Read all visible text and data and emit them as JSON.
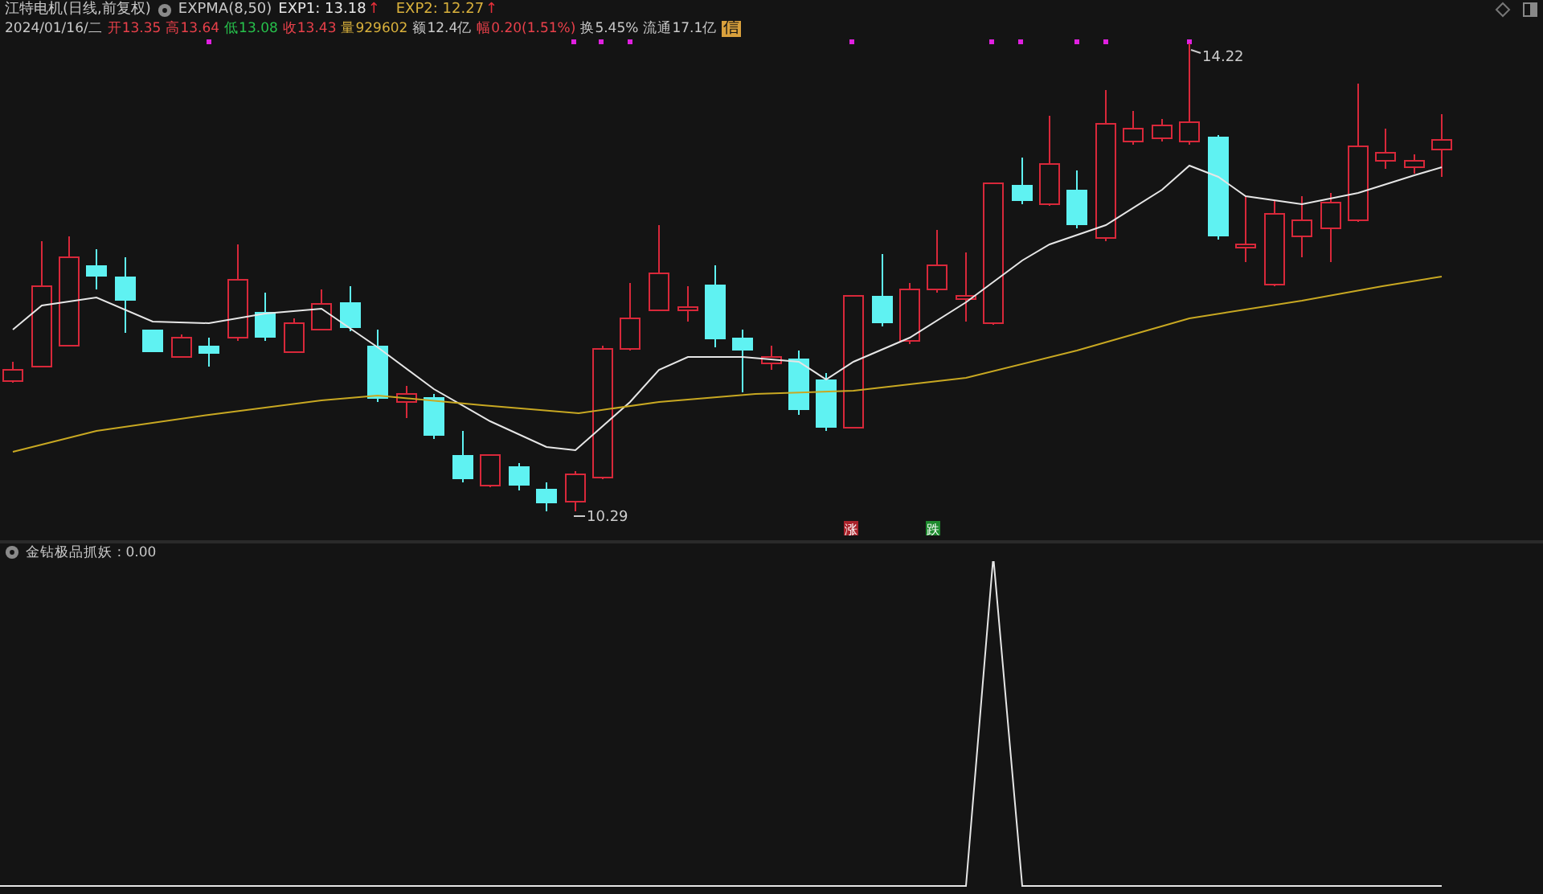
{
  "header": {
    "title": "江特电机(日线,前复权)",
    "indicator": "EXPMA(8,50)",
    "exp1": {
      "text": "EXP1: 13.18",
      "arrow": "↑"
    },
    "exp2": {
      "text": "EXP2: 12.27",
      "arrow": "↑"
    }
  },
  "quote": {
    "date": "2024/01/16/二",
    "badge": "信",
    "fields": [
      {
        "label": "开",
        "value": "13.35",
        "color": "#e8404a"
      },
      {
        "label": "高",
        "value": "13.64",
        "color": "#e8404a"
      },
      {
        "label": "低",
        "value": "13.08",
        "color": "#27c24c"
      },
      {
        "label": "收",
        "value": "13.43",
        "color": "#e8404a"
      },
      {
        "label": "量",
        "value": "929602",
        "color": "#d9b13c"
      },
      {
        "label": "额",
        "value": "12.4亿",
        "color": "#c8c8c8"
      },
      {
        "label": "幅",
        "value": "0.20(1.51%)",
        "color": "#e8404a"
      },
      {
        "label": "换",
        "value": "5.45%",
        "color": "#c8c8c8"
      },
      {
        "label": "流通",
        "value": "17.1亿",
        "color": "#c8c8c8"
      }
    ]
  },
  "main_chart": {
    "high_label": "14.22",
    "low_label": "10.29",
    "markers": [
      {
        "text": "涨",
        "color": "#a8232b"
      },
      {
        "text": "跌",
        "color": "#1e8a2e"
      }
    ]
  },
  "sub_chart": {
    "label": "金钻极品抓妖 : 0.00"
  }
}
